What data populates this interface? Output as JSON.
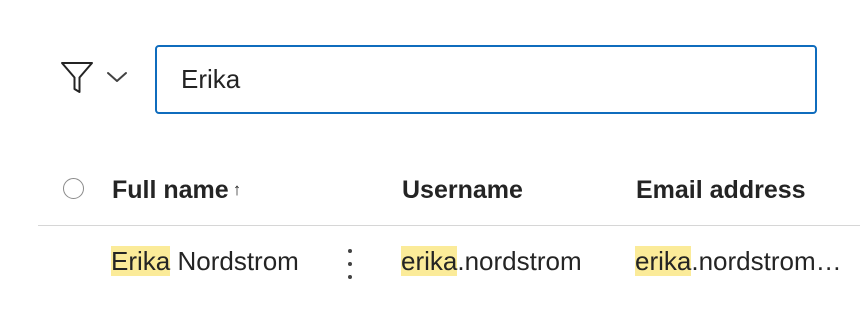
{
  "filter": {
    "icon": "filter-icon",
    "chevron_icon": "chevron-down-icon"
  },
  "search": {
    "value": "Erika",
    "placeholder": ""
  },
  "table": {
    "columns": {
      "full_name": "Full name",
      "sort_indicator": "↑",
      "username": "Username",
      "email": "Email address"
    },
    "rows": [
      {
        "full_name": {
          "match": "Erika",
          "rest": " Nordstrom"
        },
        "username": {
          "match": "erika",
          "rest": ".nordstrom"
        },
        "email": {
          "match": "erika",
          "rest": ".nordstrom…"
        }
      }
    ]
  },
  "colors": {
    "accent": "#0f6cbd",
    "highlight": "#fbeb99",
    "text": "#242424"
  }
}
